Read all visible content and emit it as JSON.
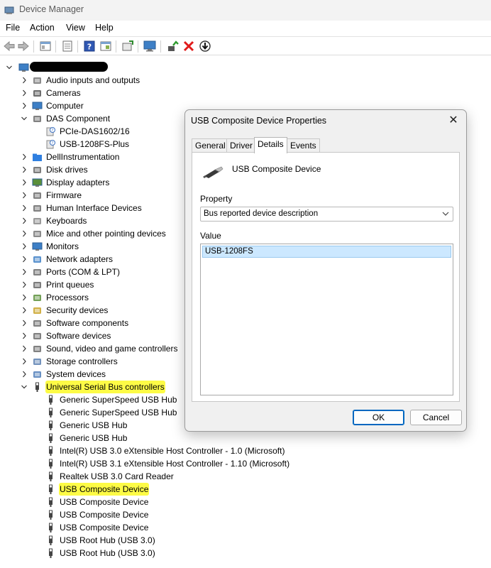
{
  "window": {
    "title": "Device Manager"
  },
  "menu": [
    "File",
    "Action",
    "View",
    "Help"
  ],
  "toolbar": [
    "back-icon",
    "forward-icon",
    "properties-icon",
    "list-icon",
    "help-icon",
    "view-icon",
    "scan-icon",
    "monitor-icon",
    "enable-icon",
    "uninstall-icon",
    "update-icon"
  ],
  "tree": {
    "root_name_redacted": true,
    "categories": [
      {
        "label": "Audio inputs and outputs",
        "icon": "speaker-icon",
        "expanded": false
      },
      {
        "label": "Cameras",
        "icon": "camera-icon",
        "expanded": false
      },
      {
        "label": "Computer",
        "icon": "computer-icon",
        "expanded": false
      },
      {
        "label": "DAS Component",
        "icon": "das-icon",
        "expanded": true,
        "children": [
          {
            "label": "PCIe-DAS1602/16",
            "icon": "unknown-device-icon"
          },
          {
            "label": "USB-1208FS-Plus",
            "icon": "unknown-device-icon"
          }
        ]
      },
      {
        "label": "DellInstrumentation",
        "icon": "folder-icon",
        "expanded": false
      },
      {
        "label": "Disk drives",
        "icon": "disk-icon",
        "expanded": false
      },
      {
        "label": "Display adapters",
        "icon": "display-icon",
        "expanded": false
      },
      {
        "label": "Firmware",
        "icon": "firmware-icon",
        "expanded": false
      },
      {
        "label": "Human Interface Devices",
        "icon": "hid-icon",
        "expanded": false
      },
      {
        "label": "Keyboards",
        "icon": "keyboard-icon",
        "expanded": false
      },
      {
        "label": "Mice and other pointing devices",
        "icon": "mouse-icon",
        "expanded": false
      },
      {
        "label": "Monitors",
        "icon": "monitor-icon",
        "expanded": false
      },
      {
        "label": "Network adapters",
        "icon": "network-icon",
        "expanded": false
      },
      {
        "label": "Ports (COM & LPT)",
        "icon": "port-icon",
        "expanded": false
      },
      {
        "label": "Print queues",
        "icon": "printer-icon",
        "expanded": false
      },
      {
        "label": "Processors",
        "icon": "processor-icon",
        "expanded": false
      },
      {
        "label": "Security devices",
        "icon": "security-icon",
        "expanded": false
      },
      {
        "label": "Software components",
        "icon": "software-component-icon",
        "expanded": false
      },
      {
        "label": "Software devices",
        "icon": "software-device-icon",
        "expanded": false
      },
      {
        "label": "Sound, video and game controllers",
        "icon": "sound-icon",
        "expanded": false
      },
      {
        "label": "Storage controllers",
        "icon": "storage-icon",
        "expanded": false
      },
      {
        "label": "System devices",
        "icon": "system-icon",
        "expanded": false
      },
      {
        "label": "Universal Serial Bus controllers",
        "icon": "usb-icon",
        "expanded": true,
        "highlighted": true,
        "children": [
          {
            "label": "Generic SuperSpeed USB Hub",
            "icon": "usb-icon"
          },
          {
            "label": "Generic SuperSpeed USB Hub",
            "icon": "usb-icon"
          },
          {
            "label": "Generic USB Hub",
            "icon": "usb-icon"
          },
          {
            "label": "Generic USB Hub",
            "icon": "usb-icon"
          },
          {
            "label": "Intel(R) USB 3.0 eXtensible Host Controller - 1.0 (Microsoft)",
            "icon": "usb-icon"
          },
          {
            "label": "Intel(R) USB 3.1 eXtensible Host Controller - 1.10 (Microsoft)",
            "icon": "usb-icon"
          },
          {
            "label": "Realtek USB 3.0 Card Reader",
            "icon": "usb-icon"
          },
          {
            "label": "USB Composite Device",
            "icon": "usb-icon",
            "highlighted": true
          },
          {
            "label": "USB Composite Device",
            "icon": "usb-icon"
          },
          {
            "label": "USB Composite Device",
            "icon": "usb-icon"
          },
          {
            "label": "USB Composite Device",
            "icon": "usb-icon"
          },
          {
            "label": "USB Root Hub (USB 3.0)",
            "icon": "usb-icon"
          },
          {
            "label": "USB Root Hub (USB 3.0)",
            "icon": "usb-icon"
          }
        ]
      }
    ]
  },
  "dialog": {
    "title": "USB Composite Device Properties",
    "tabs": [
      "General",
      "Driver",
      "Details",
      "Events"
    ],
    "active_tab": "Details",
    "device_name": "USB Composite Device",
    "property_label": "Property",
    "property_value": "Bus reported device description",
    "value_label": "Value",
    "values": [
      "USB-1208FS"
    ],
    "ok_label": "OK",
    "cancel_label": "Cancel"
  },
  "colors": {
    "highlight": "#fdfb46",
    "selection": "#cce8ff",
    "accent": "#0067c0"
  }
}
